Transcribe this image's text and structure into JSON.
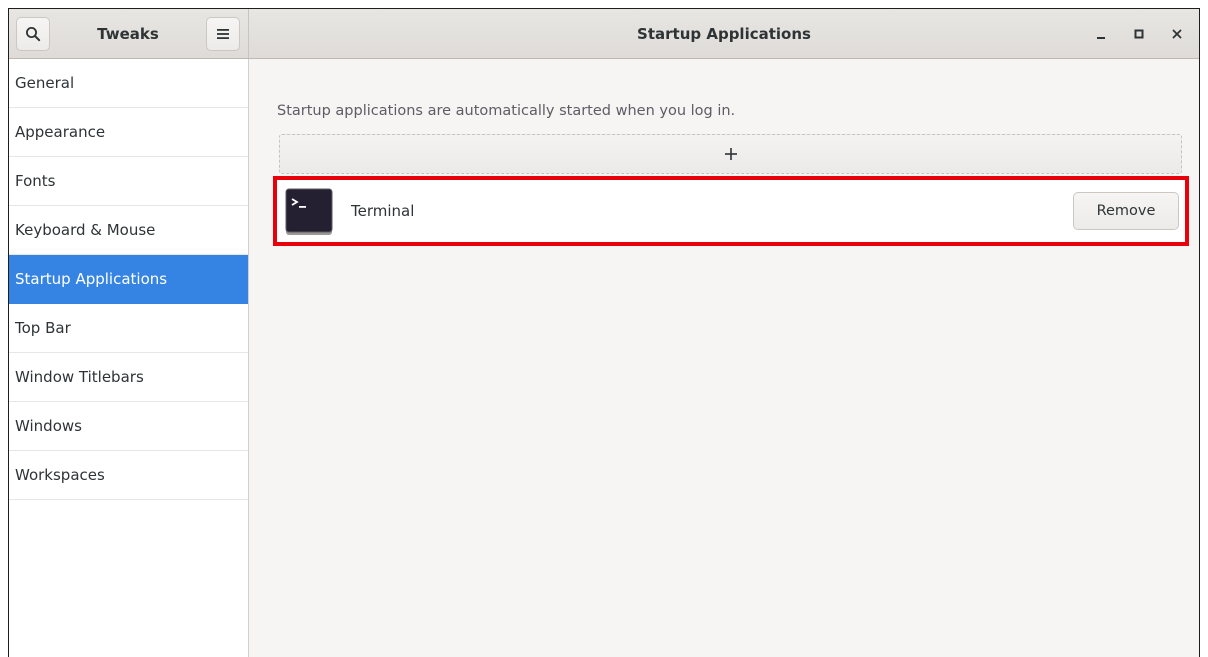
{
  "header": {
    "app_title": "Tweaks",
    "page_title": "Startup Applications",
    "search_icon": "search-icon",
    "menu_icon": "hamburger-menu-icon",
    "controls": [
      "minimize-icon",
      "maximize-icon",
      "close-icon"
    ]
  },
  "sidebar": {
    "items": [
      {
        "label": "General"
      },
      {
        "label": "Appearance"
      },
      {
        "label": "Fonts"
      },
      {
        "label": "Keyboard & Mouse"
      },
      {
        "label": "Startup Applications",
        "selected": true
      },
      {
        "label": "Top Bar"
      },
      {
        "label": "Window Titlebars"
      },
      {
        "label": "Windows"
      },
      {
        "label": "Workspaces"
      }
    ]
  },
  "main": {
    "description": "Startup applications are automatically started when you log in.",
    "add_icon": "plus-icon",
    "apps": [
      {
        "name": "Terminal",
        "icon": "terminal-icon",
        "remove_label": "Remove"
      }
    ]
  },
  "colors": {
    "accent": "#3584e4",
    "highlight": "#e8000b"
  }
}
